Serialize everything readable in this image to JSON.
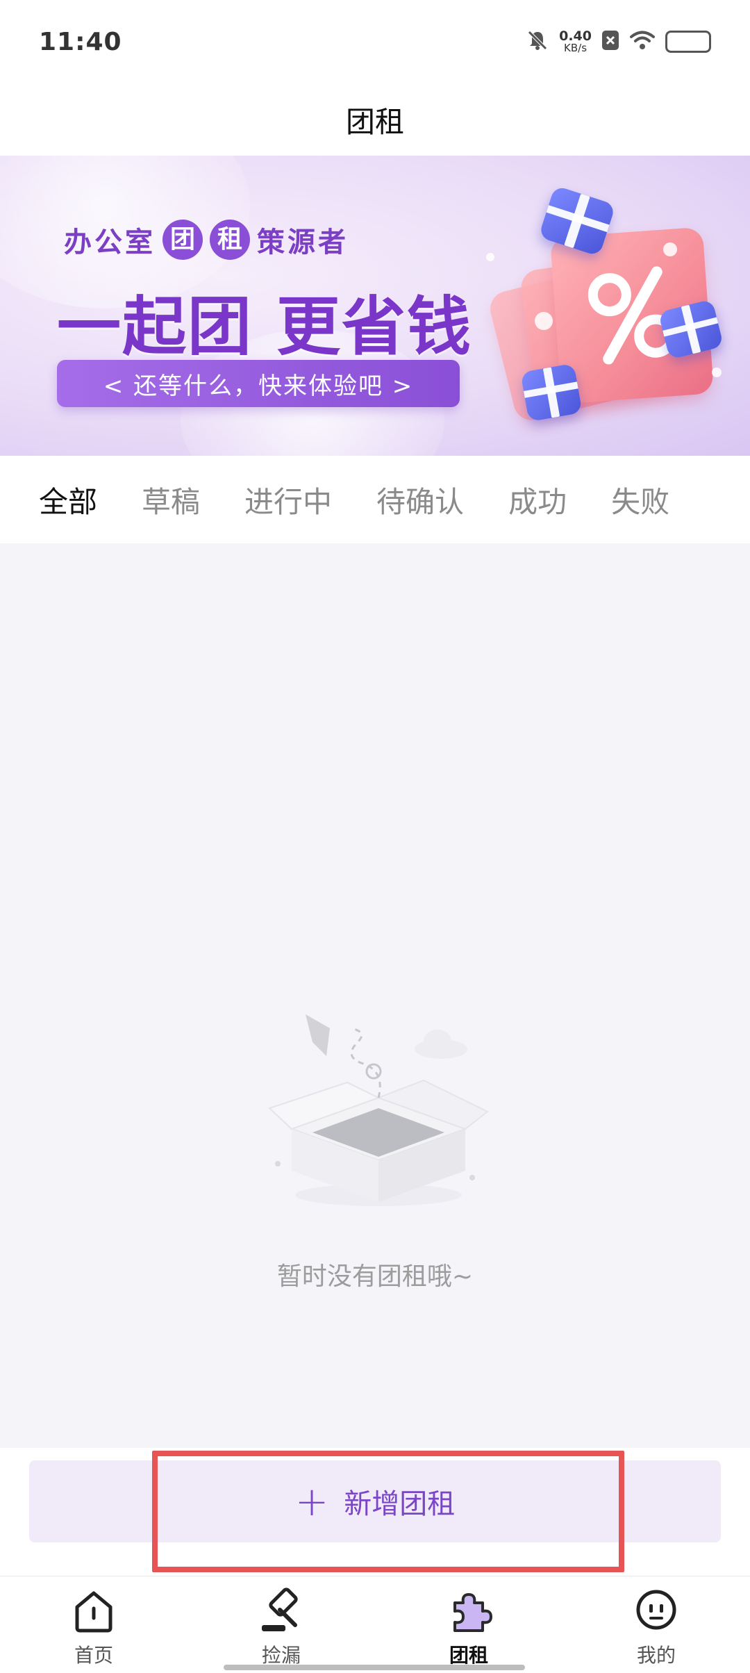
{
  "status_bar": {
    "time": "11:40",
    "net_speed_value": "0.40",
    "net_speed_unit": "KB/s",
    "icons": [
      "mute-icon",
      "net-speed-indicator",
      "sim-disabled-icon",
      "wifi-icon",
      "battery-icon"
    ]
  },
  "header": {
    "title": "团租"
  },
  "banner": {
    "small_line_start": "办公室",
    "small_word_1": "团",
    "small_word_2": "租",
    "small_line_end": "策源者",
    "big_line": "一起团 更省钱",
    "cta": "< 还等什么，快来体验吧 >",
    "colors": {
      "accent": "#8a4fd6",
      "coupon": "#f58c98",
      "gift": "#4b56d9"
    }
  },
  "tabs": [
    {
      "label": "全部",
      "active": true
    },
    {
      "label": "草稿",
      "active": false
    },
    {
      "label": "进行中",
      "active": false
    },
    {
      "label": "待确认",
      "active": false
    },
    {
      "label": "成功",
      "active": false
    },
    {
      "label": "失败",
      "active": false
    }
  ],
  "empty_state": {
    "message": "暂时没有团租哦~"
  },
  "action": {
    "plus": "+",
    "label": "新增团租",
    "highlighted": true
  },
  "bottom_nav": [
    {
      "label": "首页",
      "icon": "home-icon",
      "active": false
    },
    {
      "label": "捡漏",
      "icon": "gavel-icon",
      "active": false
    },
    {
      "label": "团租",
      "icon": "puzzle-icon",
      "active": true
    },
    {
      "label": "我的",
      "icon": "profile-face-icon",
      "active": false
    }
  ]
}
